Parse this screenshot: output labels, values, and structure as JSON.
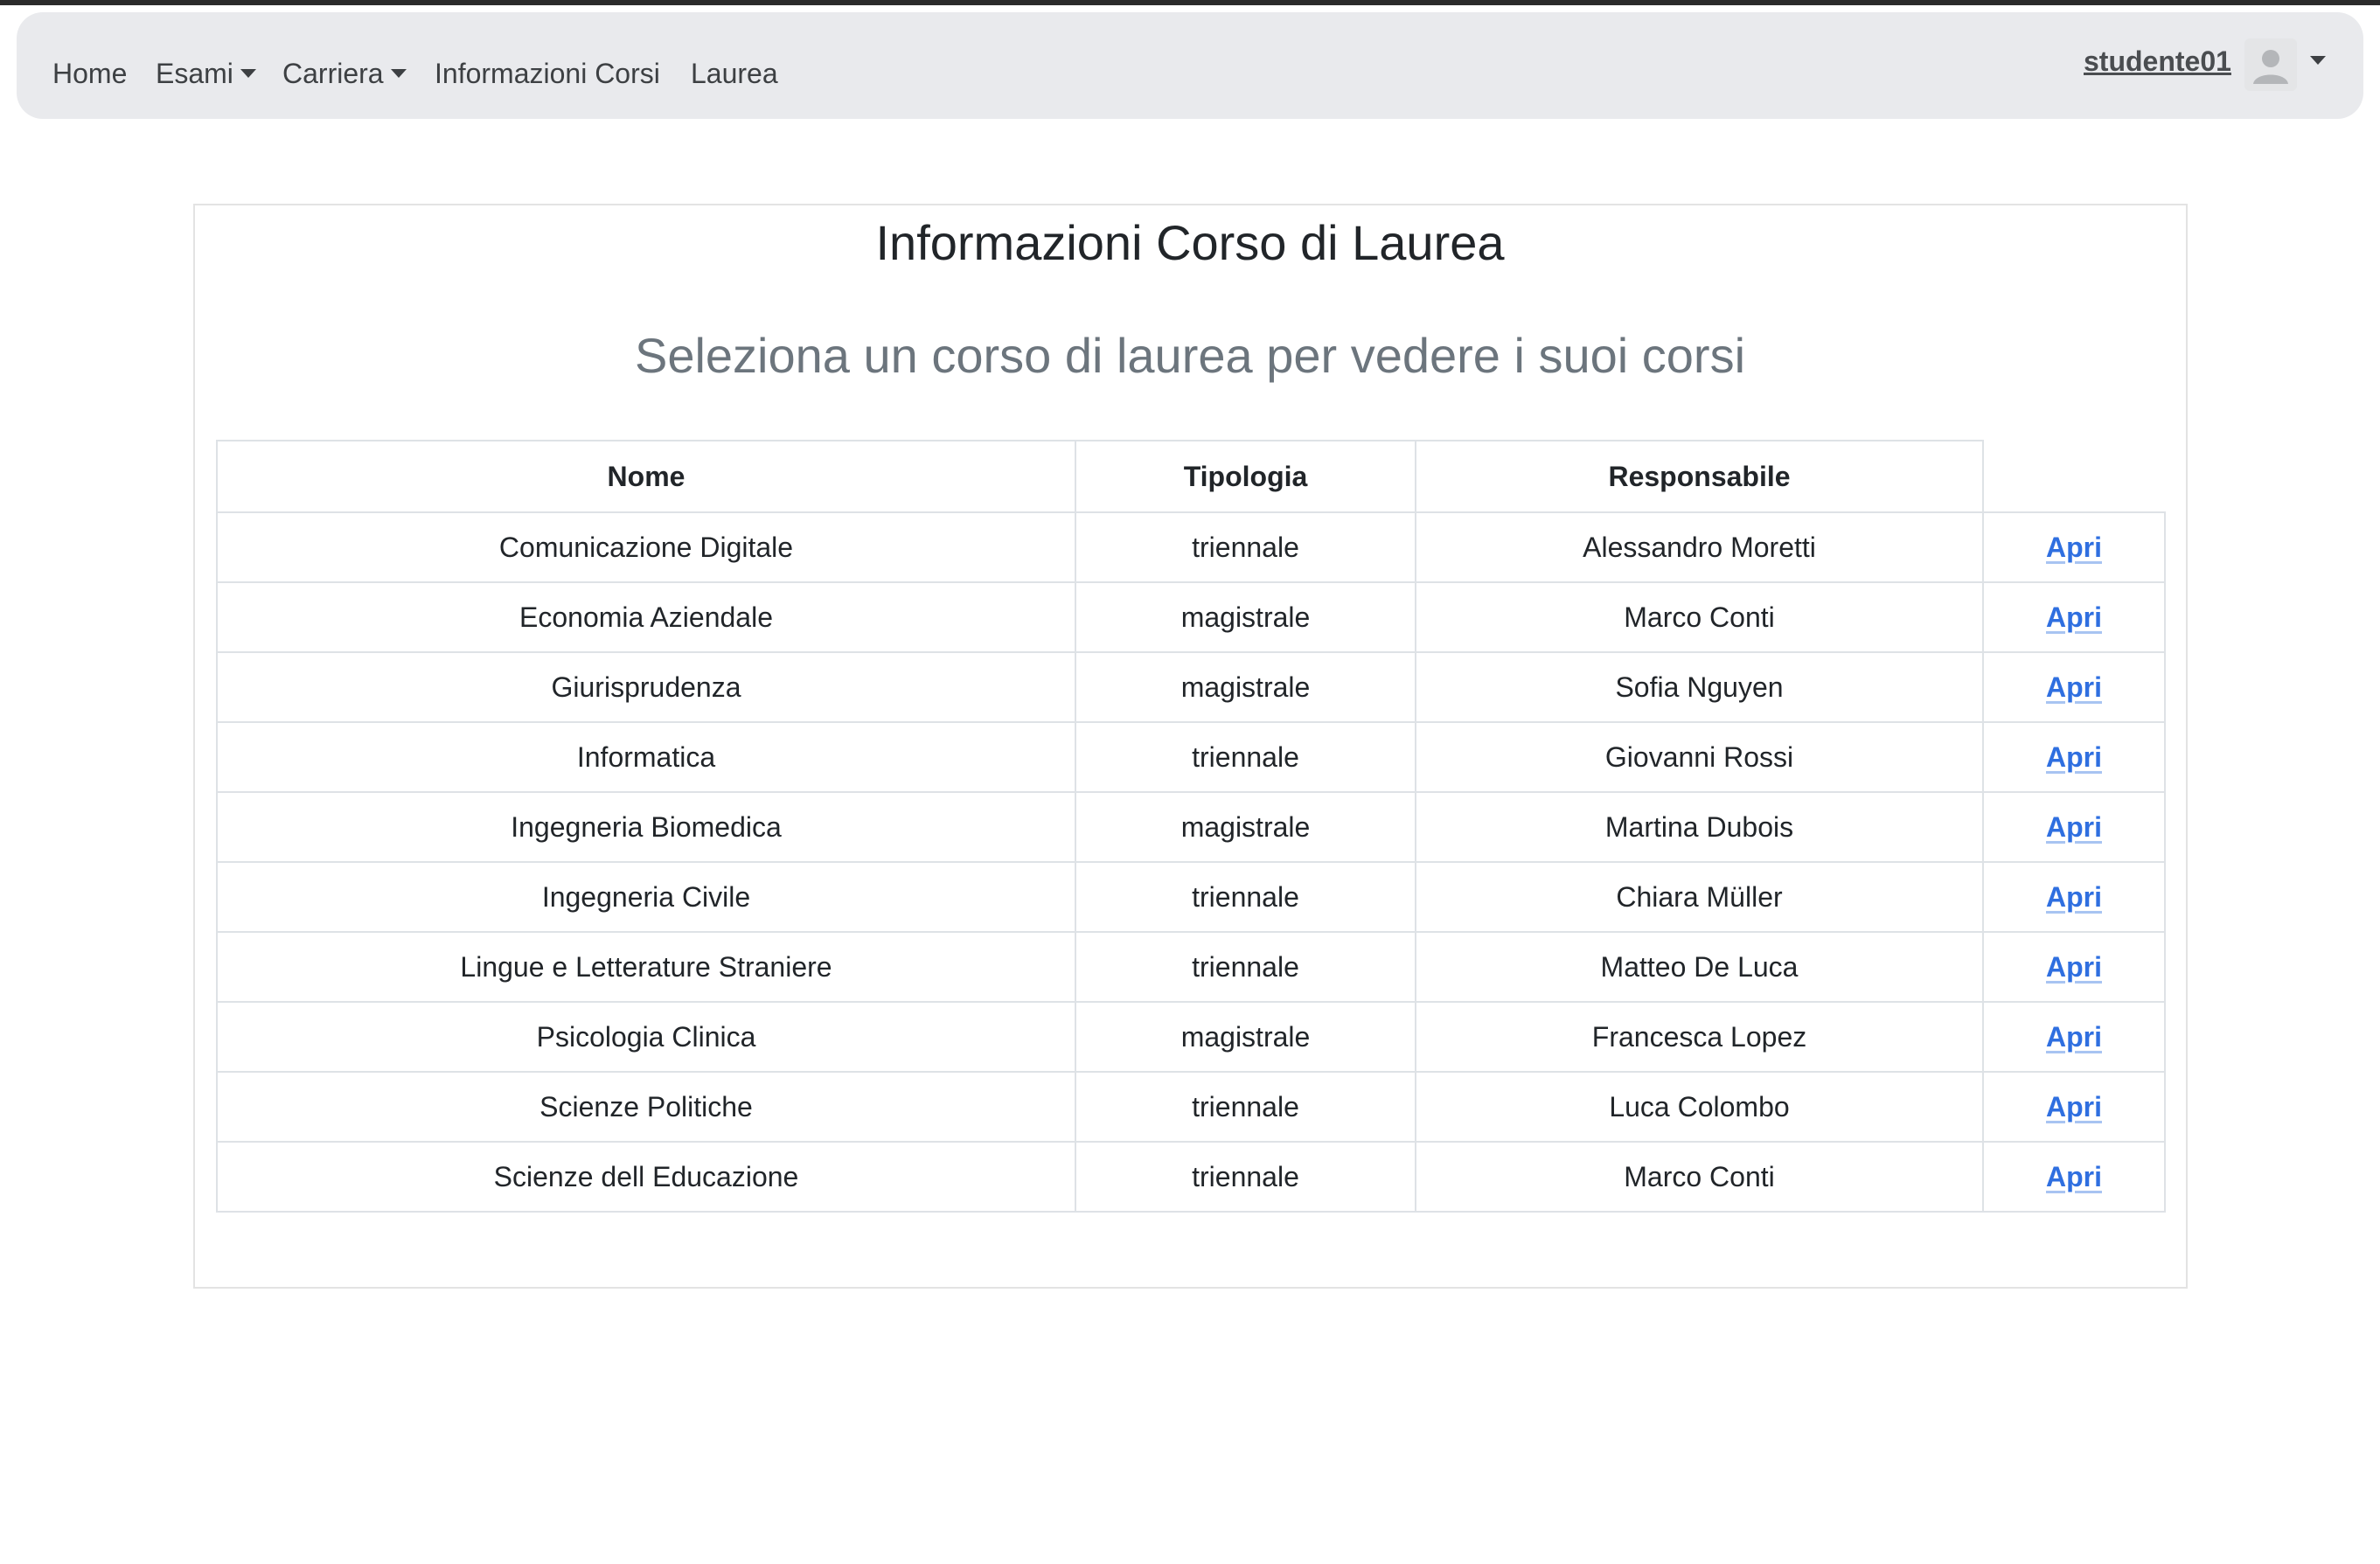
{
  "navbar": {
    "items": [
      {
        "label": "Home",
        "has_caret": false
      },
      {
        "label": "Esami",
        "has_caret": true
      },
      {
        "label": "Carriera",
        "has_caret": true
      },
      {
        "label": "Informazioni Corsi",
        "has_caret": false
      },
      {
        "label": "Laurea",
        "has_caret": false
      }
    ],
    "user": {
      "username": "studente01",
      "avatar_icon": "user-avatar-icon",
      "menu_icon": "chevron-down-icon"
    }
  },
  "main": {
    "title": "Informazioni Corso di Laurea",
    "subtitle": "Seleziona un corso di laurea per vedere i suoi corsi",
    "table": {
      "headers": [
        "Nome",
        "Tipologia",
        "Responsabile",
        ""
      ],
      "action_label": "Apri",
      "rows": [
        {
          "nome": "Comunicazione Digitale",
          "tipologia": "triennale",
          "responsabile": "Alessandro Moretti"
        },
        {
          "nome": "Economia Aziendale",
          "tipologia": "magistrale",
          "responsabile": "Marco Conti"
        },
        {
          "nome": "Giurisprudenza",
          "tipologia": "magistrale",
          "responsabile": "Sofia Nguyen"
        },
        {
          "nome": "Informatica",
          "tipologia": "triennale",
          "responsabile": "Giovanni Rossi"
        },
        {
          "nome": "Ingegneria Biomedica",
          "tipologia": "magistrale",
          "responsabile": "Martina Dubois"
        },
        {
          "nome": "Ingegneria Civile",
          "tipologia": "triennale",
          "responsabile": "Chiara Müller"
        },
        {
          "nome": "Lingue e Letterature Straniere",
          "tipologia": "triennale",
          "responsabile": "Matteo De Luca"
        },
        {
          "nome": "Psicologia Clinica",
          "tipologia": "magistrale",
          "responsabile": "Francesca Lopez"
        },
        {
          "nome": "Scienze Politiche",
          "tipologia": "triennale",
          "responsabile": "Luca Colombo"
        },
        {
          "nome": "Scienze dell Educazione",
          "tipologia": "triennale",
          "responsabile": "Marco Conti"
        }
      ]
    }
  },
  "colors": {
    "navbar_bg": "#e9eaed",
    "link": "#2f6fe0",
    "subtitle": "#6c757d",
    "border": "#dee2e6"
  }
}
